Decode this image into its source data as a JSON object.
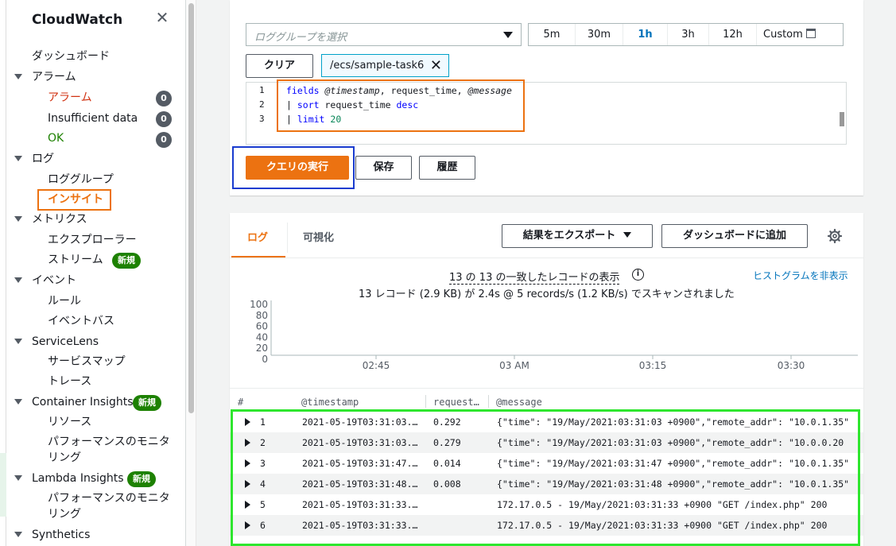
{
  "sidebar": {
    "title": "CloudWatch",
    "dashboard": "ダッシュボード",
    "alarm_section": "アラーム",
    "alarm_item": "アラーム",
    "alarm_count": "0",
    "insufficient": "Insufficient data",
    "insufficient_count": "0",
    "ok": "OK",
    "ok_count": "0",
    "log_section": "ログ",
    "log_groups": "ロググループ",
    "insights": "インサイト",
    "metrics_section": "メトリクス",
    "explorer": "エクスプローラー",
    "stream": "ストリーム",
    "new_badge": "新規",
    "event_section": "イベント",
    "rules": "ルール",
    "event_bus": "イベントバス",
    "servicelens": "ServiceLens",
    "service_map": "サービスマップ",
    "traces": "トレース",
    "container_insights": "Container Insights",
    "resources": "リソース",
    "perf_monitoring_1": "パフォーマンスのモニタ",
    "perf_monitoring_2": "リング",
    "lambda_insights": "Lambda Insights",
    "synthetics": "Synthetics"
  },
  "query": {
    "log_group_placeholder": "ロググループを選択",
    "time_options": [
      "5m",
      "30m",
      "1h",
      "3h",
      "12h"
    ],
    "time_active": "1h",
    "custom": "Custom",
    "clear": "クリア",
    "selected_group": "/ecs/sample-task6",
    "line_numbers": [
      "1",
      "2",
      "3"
    ],
    "code": {
      "l1_kw": "fields",
      "l1_f1": "@timestamp",
      "l1_mid": ", request_time, ",
      "l1_f2": "@message",
      "l2_pipe": "| ",
      "l2_kw": "sort",
      "l2_mid": " request_time ",
      "l2_kw2": "desc",
      "l3_pipe": "| ",
      "l3_kw": "limit",
      "l3_num": "20"
    },
    "run": "クエリの実行",
    "save": "保存",
    "history": "履歴"
  },
  "results": {
    "tab_logs": "ログ",
    "tab_viz": "可視化",
    "export": "結果をエクスポート",
    "add_dashboard": "ダッシュボードに追加",
    "record_count": "13 の 13 の一致したレコードの表示",
    "hide_histogram": "ヒストグラムを非表示",
    "scan_summary": "13 レコード (2.9 KB) が 2.4s @ 5 records/s (1.2 KB/s) でスキャンされました",
    "columns": [
      "#",
      "@timestamp",
      "request…",
      "@message"
    ],
    "rows": [
      {
        "n": "1",
        "ts": "2021-05-19T03:31:03.…",
        "rt": "0.292",
        "msg": "{\"time\": \"19/May/2021:03:31:03 +0900\",\"remote_addr\": \"10.0.1.35\""
      },
      {
        "n": "2",
        "ts": "2021-05-19T03:31:03.…",
        "rt": "0.279",
        "msg": "{\"time\": \"19/May/2021:03:31:03 +0900\",\"remote_addr\": \"10.0.0.20"
      },
      {
        "n": "3",
        "ts": "2021-05-19T03:31:47.…",
        "rt": "0.014",
        "msg": "{\"time\": \"19/May/2021:03:31:47 +0900\",\"remote_addr\": \"10.0.1.35\""
      },
      {
        "n": "4",
        "ts": "2021-05-19T03:31:48.…",
        "rt": "0.008",
        "msg": "{\"time\": \"19/May/2021:03:31:48 +0900\",\"remote_addr\": \"10.0.1.35\""
      },
      {
        "n": "5",
        "ts": "2021-05-19T03:31:33.…",
        "rt": "",
        "msg": "172.17.0.5 - 19/May/2021:03:31:33 +0900 \"GET /index.php\" 200"
      },
      {
        "n": "6",
        "ts": "2021-05-19T03:31:33.…",
        "rt": "",
        "msg": "172.17.0.5 - 19/May/2021:03:31:33 +0900 \"GET /index.php\" 200"
      }
    ]
  },
  "chart_data": {
    "type": "bar",
    "title": "",
    "xlabel": "",
    "ylabel": "",
    "y_ticks": [
      "100",
      "80",
      "60",
      "40",
      "20",
      "0"
    ],
    "x_ticks": [
      "02:45",
      "03 AM",
      "03:15",
      "03:30"
    ],
    "ylim": [
      0,
      100
    ],
    "values": []
  },
  "colors": {
    "accent": "#ec7211",
    "link": "#0073bb",
    "badge_green": "#1d8102",
    "highlight_orange": "#ec7211",
    "highlight_blue": "#1a3ccf",
    "highlight_green": "#2ee62e"
  }
}
